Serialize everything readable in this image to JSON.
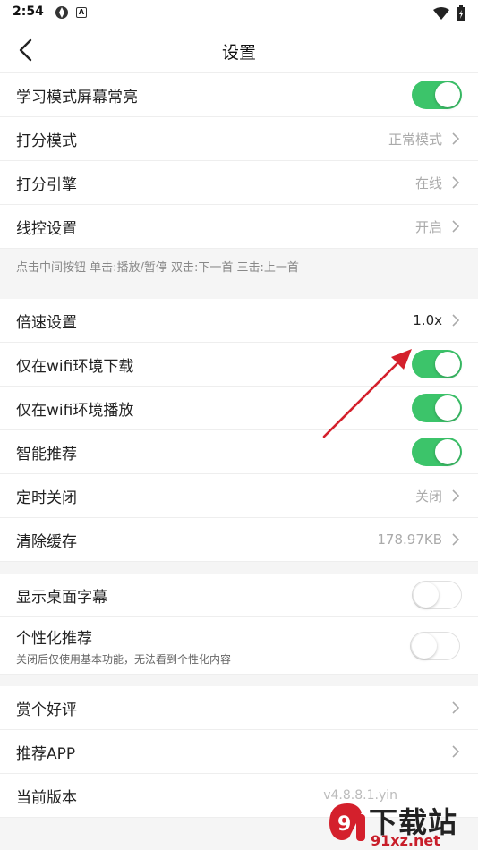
{
  "status_bar": {
    "time": "2:54"
  },
  "nav": {
    "title": "设置"
  },
  "section1": [
    {
      "label": "学习模式屏幕常亮",
      "type": "toggle",
      "on": true
    },
    {
      "label": "打分模式",
      "type": "value",
      "value": "正常模式"
    },
    {
      "label": "打分引擎",
      "type": "value",
      "value": "在线"
    },
    {
      "label": "线控设置",
      "type": "value",
      "value": "开启"
    }
  ],
  "hint": "点击中间按钮 单击:播放/暂停 双击:下一首 三击:上一首",
  "section2": [
    {
      "label": "倍速设置",
      "type": "value",
      "value": "1.0x"
    },
    {
      "label": "仅在wifi环境下载",
      "type": "toggle",
      "on": true
    },
    {
      "label": "仅在wifi环境播放",
      "type": "toggle",
      "on": true
    },
    {
      "label": "智能推荐",
      "type": "toggle",
      "on": true
    },
    {
      "label": "定时关闭",
      "type": "value",
      "value": "关闭"
    },
    {
      "label": "清除缓存",
      "type": "value",
      "value": "178.97KB"
    }
  ],
  "section3": [
    {
      "label": "显示桌面字幕",
      "type": "toggle",
      "on": false
    },
    {
      "label": "个性化推荐",
      "sub": "关闭后仅使用基本功能，无法看到个性化内容",
      "type": "toggle",
      "on": false
    }
  ],
  "section4": [
    {
      "label": "赏个好评",
      "type": "link"
    },
    {
      "label": "推荐APP",
      "type": "link"
    },
    {
      "label": "当前版本",
      "type": "version",
      "value": "v4.8.8.1.yin"
    }
  ],
  "watermark": {
    "text": "下载站",
    "url": "91xz.net"
  },
  "colors": {
    "toggle_on": "#3cc46a",
    "accent_red": "#d4202c"
  }
}
